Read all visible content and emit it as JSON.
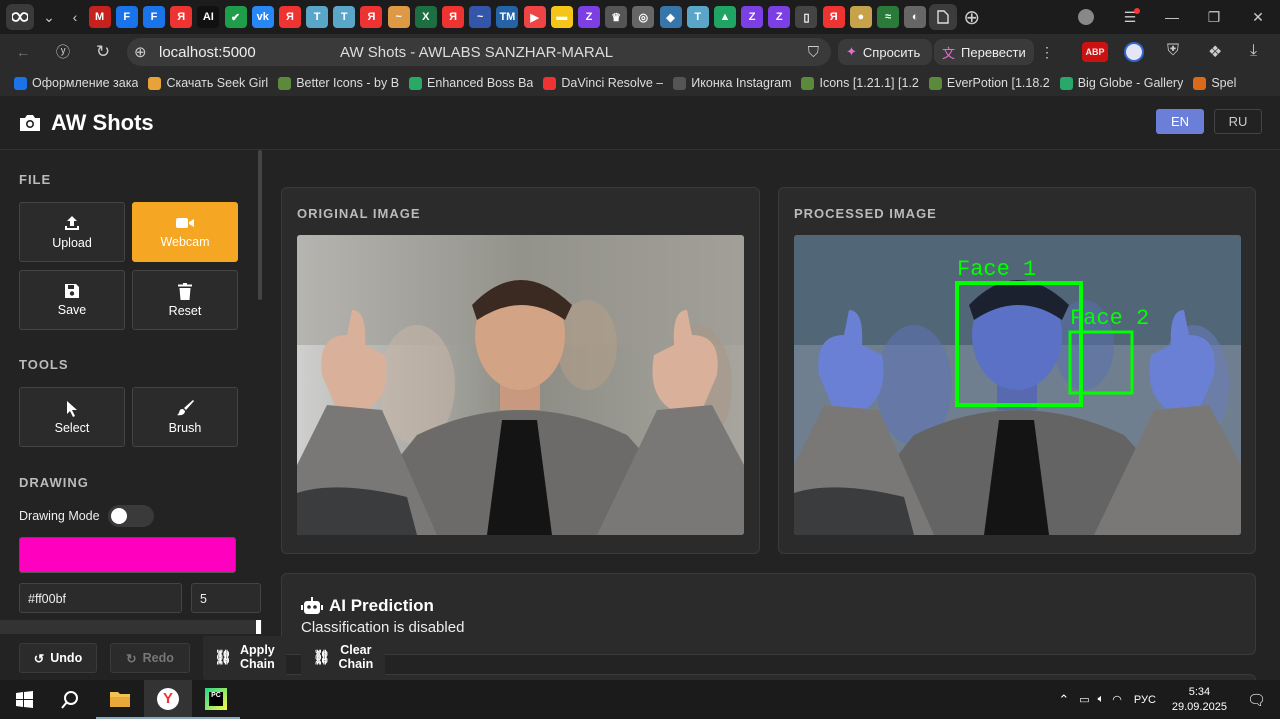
{
  "browser": {
    "url": "localhost:5000",
    "page_title": "AW Shots - AWLABS SANZHAR-MARAL",
    "ask_label": "Спросить",
    "translate_label": "Перевести",
    "abp_badge": "ABP"
  },
  "tab_favicons": [
    {
      "label": "M",
      "color": "#c5221f"
    },
    {
      "label": "F",
      "color": "#1a73e8"
    },
    {
      "label": "F",
      "color": "#1a73e8"
    },
    {
      "label": "Я",
      "color": "#e33"
    },
    {
      "label": "AI",
      "color": "#111"
    },
    {
      "label": "✔",
      "color": "#1e9e4a"
    },
    {
      "label": "vk",
      "color": "#2787f5"
    },
    {
      "label": "Я",
      "color": "#e33"
    },
    {
      "label": "T",
      "color": "#5aa6c8"
    },
    {
      "label": "T",
      "color": "#5aa6c8"
    },
    {
      "label": "Я",
      "color": "#e33"
    },
    {
      "label": "~",
      "color": "#d94"
    },
    {
      "label": "X",
      "color": "#1d6f42"
    },
    {
      "label": "Я",
      "color": "#e33"
    },
    {
      "label": "~",
      "color": "#35a"
    },
    {
      "label": "TM",
      "color": "#2463a6"
    },
    {
      "label": "▶",
      "color": "#e44"
    },
    {
      "label": "▬",
      "color": "#f5c518"
    },
    {
      "label": "Z",
      "color": "#7b3fe4"
    },
    {
      "label": "♛",
      "color": "#555"
    },
    {
      "label": "◎",
      "color": "#666"
    },
    {
      "label": "◆",
      "color": "#3776ab"
    },
    {
      "label": "T",
      "color": "#5aa6c8"
    },
    {
      "label": "▲",
      "color": "#1fa463"
    },
    {
      "label": "Z",
      "color": "#7b3fe4"
    },
    {
      "label": "Z",
      "color": "#7b3fe4"
    },
    {
      "label": "▯",
      "color": "#444"
    },
    {
      "label": "Я",
      "color": "#e33"
    },
    {
      "label": "●",
      "color": "#c8a24a"
    },
    {
      "label": "≈",
      "color": "#2a7a3a"
    },
    {
      "label": "◐",
      "color": "#666"
    }
  ],
  "bookmarks": [
    {
      "label": "Оформление зака",
      "color": "#1a73e8"
    },
    {
      "label": "Скачать Seek Girl",
      "color": "#e8a23a"
    },
    {
      "label": "Better Icons - by B",
      "color": "#5b8a3a"
    },
    {
      "label": "Enhanced Boss Ba",
      "color": "#2aa86a"
    },
    {
      "label": "DaVinci Resolve –",
      "color": "#e33"
    },
    {
      "label": "Иконка Instagram",
      "color": "#555"
    },
    {
      "label": "Icons [1.21.1] [1.2",
      "color": "#5b8a3a"
    },
    {
      "label": "EverPotion [1.18.2",
      "color": "#5b8a3a"
    },
    {
      "label": "Big Globe - Gallery",
      "color": "#2aa86a"
    },
    {
      "label": "Spel",
      "color": "#d86a1a"
    }
  ],
  "app": {
    "title": "AW Shots",
    "lang_en": "EN",
    "lang_ru": "RU"
  },
  "sidebar": {
    "file_title": "FILE",
    "upload": "Upload",
    "webcam": "Webcam",
    "save": "Save",
    "reset": "Reset",
    "tools_title": "TOOLS",
    "select": "Select",
    "brush": "Brush",
    "drawing_title": "DRAWING",
    "drawing_mode": "Drawing Mode",
    "color_value": "#ff00bf",
    "brush_size": "5"
  },
  "colors": {
    "accent": "#f5a623",
    "lang_active": "#6c7fd8",
    "draw_color": "#ff00bf",
    "face_box": "#00ff00"
  },
  "cards": {
    "original_title": "ORIGINAL IMAGE",
    "processed_title": "PROCESSED IMAGE",
    "face_1": "Face 1",
    "face_2": "Face 2"
  },
  "prediction": {
    "title": "AI Prediction",
    "status": "Classification is disabled"
  },
  "bottom": {
    "undo": "Undo",
    "redo": "Redo",
    "apply_line1": "Apply",
    "apply_line2": "Chain",
    "clear_line1": "Clear",
    "clear_line2": "Chain"
  },
  "taskbar": {
    "lang": "РУС",
    "time": "5:34",
    "date": "29.09.2025"
  }
}
